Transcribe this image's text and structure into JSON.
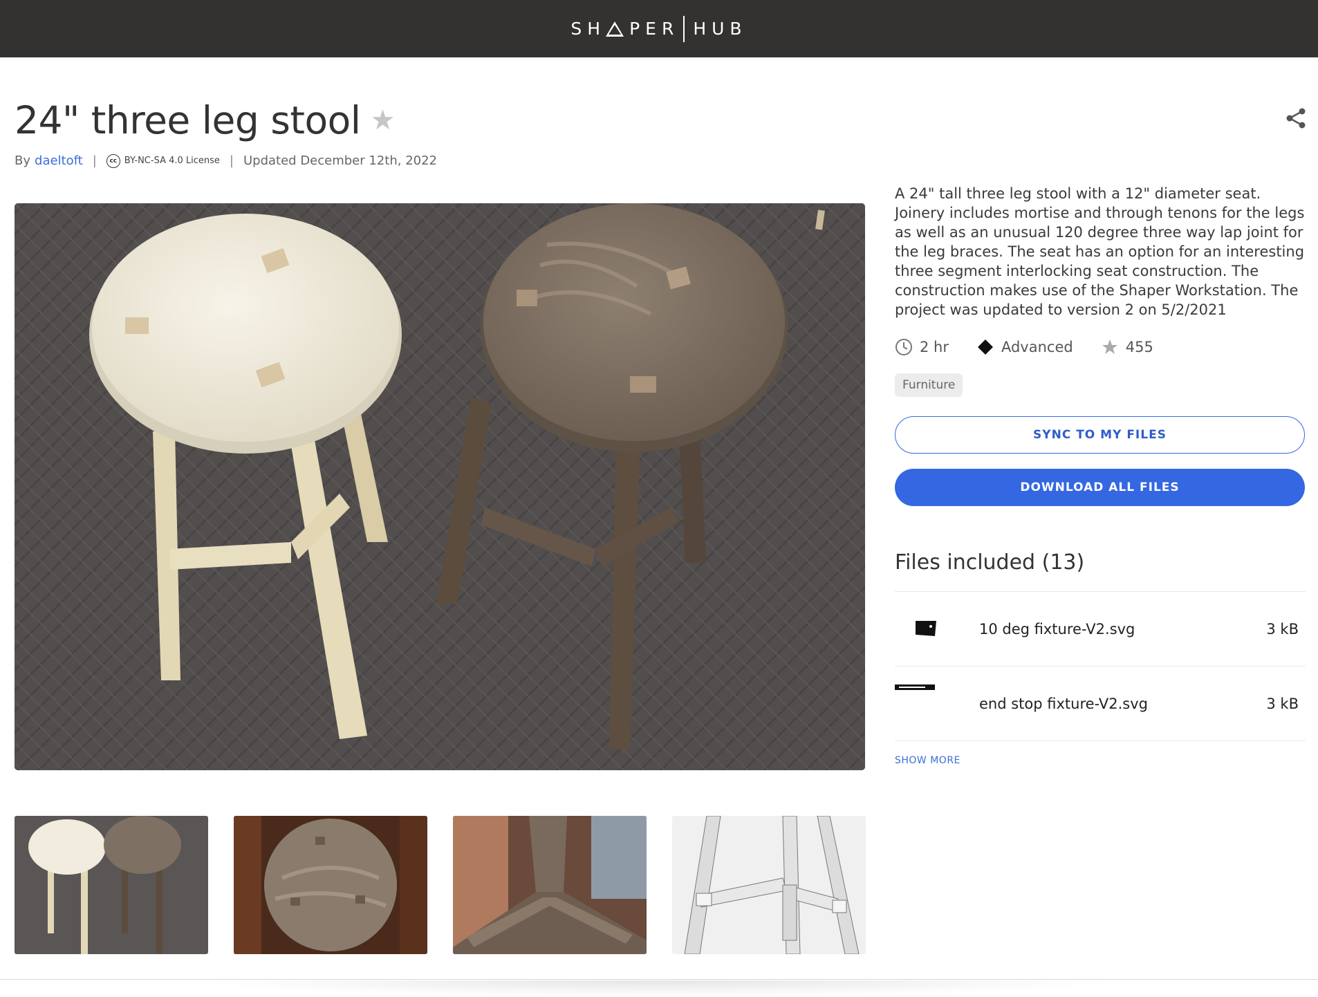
{
  "header": {
    "brand_left": "SH",
    "brand_mid": "PER",
    "brand_right": "HUB"
  },
  "project": {
    "title": "24\" three leg stool",
    "by_prefix": "By",
    "author": "daeltoft",
    "license": "BY-NC-SA 4.0 License",
    "updated": "Updated December 12th, 2022",
    "description": "A 24\" tall three leg stool with a 12\" diameter seat. Joinery includes mortise and through tenons for the legs as well as an unusual 120 degree three way lap joint for the leg braces. The seat has an option for an interesting three segment interlocking seat construction. The construction makes use of the Shaper Workstation. The project was updated to version 2 on 5/2/2021",
    "time": "2 hr",
    "difficulty": "Advanced",
    "favorites": "455",
    "tag": "Furniture"
  },
  "actions": {
    "sync_label": "SYNC TO MY FILES",
    "download_label": "DOWNLOAD ALL FILES",
    "show_more_label": "SHOW MORE"
  },
  "files": {
    "title": "Files included (13)",
    "items": [
      {
        "name": "10 deg fixture-V2.svg",
        "size": "3 kB"
      },
      {
        "name": "end stop fixture-V2.svg",
        "size": "3 kB"
      }
    ]
  },
  "colors": {
    "topbar": "#333230",
    "accent": "#3467e1",
    "link": "#3a6fd6"
  }
}
